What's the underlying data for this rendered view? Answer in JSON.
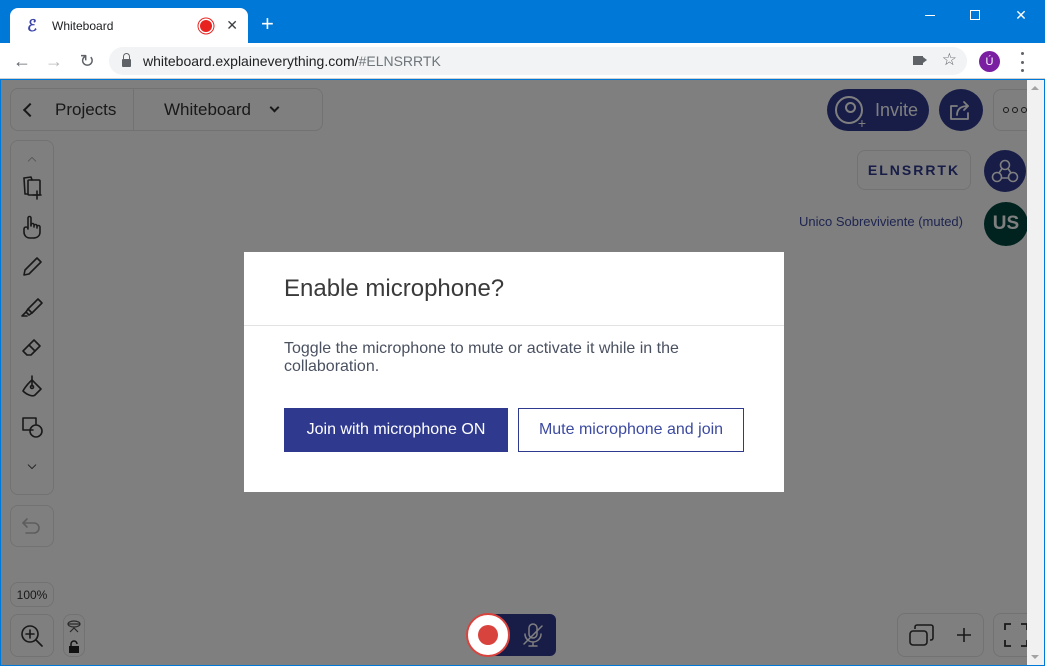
{
  "browser": {
    "tab_title": "Whiteboard",
    "favicon_glyph": "ℰ",
    "tab_recording_indicator": true,
    "new_tab_label": "+",
    "url_host": "whiteboard.explaineverything.com/",
    "url_hash": "#ELNSRRTK",
    "profile_initial": "Ú",
    "icons": [
      "back-arrow",
      "forward-arrow",
      "reload",
      "lock",
      "camera",
      "star",
      "kebab-menu"
    ],
    "window_controls": [
      "minimize",
      "maximize",
      "close"
    ]
  },
  "app": {
    "nav": {
      "back_label": "Projects",
      "board_name": "Whiteboard"
    },
    "header": {
      "invite_label": "Invite",
      "share_icon": "share-icon",
      "more_icon": "more-icon"
    },
    "session": {
      "code": "ELNSRRTK",
      "participant_name": "Unico Sobreviviente (muted)",
      "participant_initials": "US"
    },
    "tools": [
      {
        "name": "scroll-up",
        "icon": "chevron-up-icon"
      },
      {
        "name": "add-slide",
        "icon": "add-slide-icon"
      },
      {
        "name": "hand",
        "icon": "hand-icon"
      },
      {
        "name": "pen",
        "icon": "pen-icon"
      },
      {
        "name": "highlighter",
        "icon": "highlighter-icon"
      },
      {
        "name": "eraser",
        "icon": "eraser-icon"
      },
      {
        "name": "fill",
        "icon": "fill-bucket-icon"
      },
      {
        "name": "shapes",
        "icon": "shapes-icon"
      },
      {
        "name": "scroll-down",
        "icon": "chevron-down-icon"
      }
    ],
    "zoom_level": "100%",
    "colors": {
      "brand": "#2f3a8f",
      "record": "#d9433e",
      "avatar": "#00473e"
    }
  },
  "dialog": {
    "title": "Enable microphone?",
    "body": "Toggle the microphone to mute or activate it while in the collaboration.",
    "primary_label": "Join with microphone ON",
    "secondary_label": "Mute microphone and join"
  }
}
